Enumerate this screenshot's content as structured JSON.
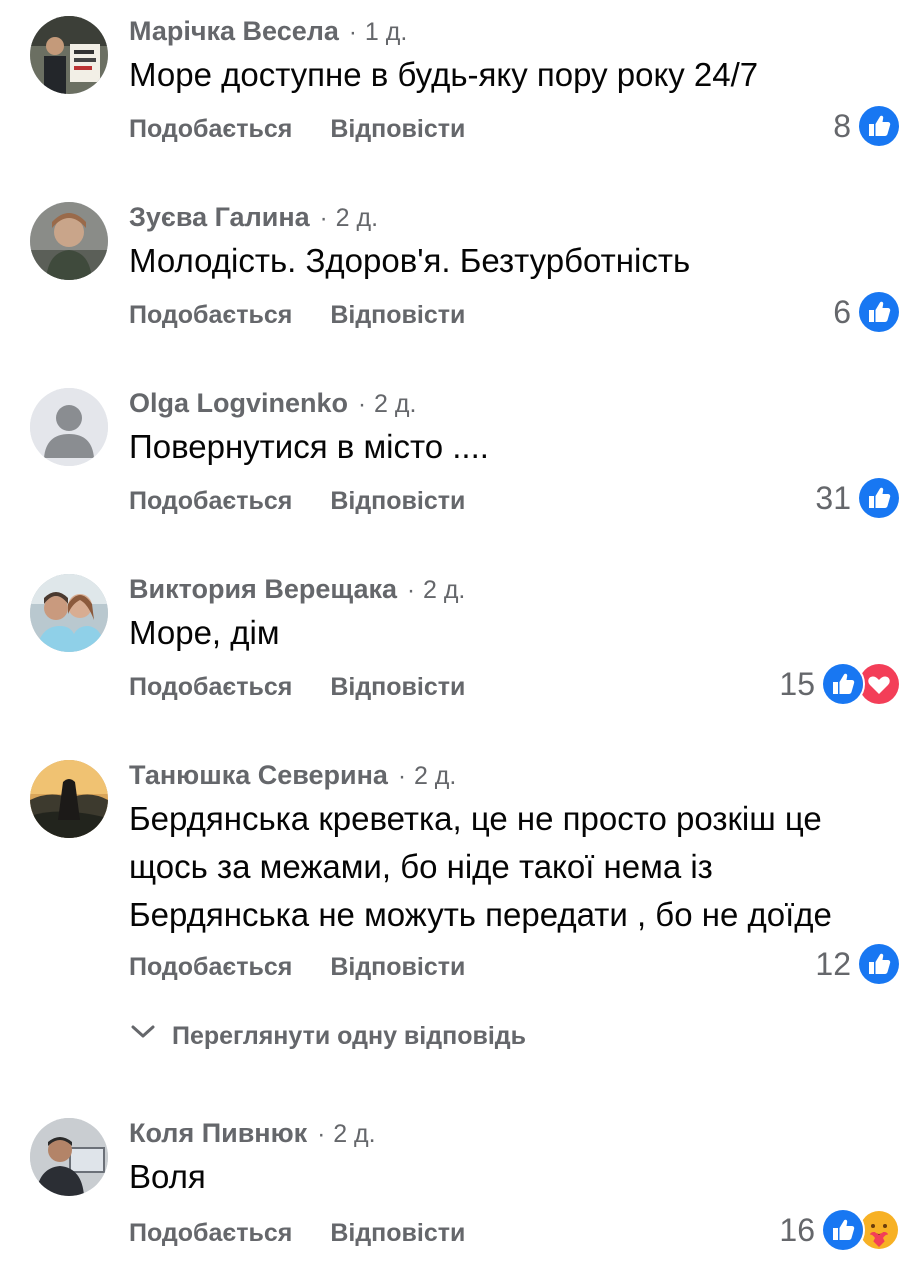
{
  "action_labels": {
    "like": "Подобається",
    "reply": "Відповісти"
  },
  "comments": [
    {
      "author": "Марічка Весела",
      "time": "1 д.",
      "text": "Море доступне в будь-яку пору року 24/7",
      "count": "8",
      "reactions": [
        "like"
      ],
      "avatar": "photo-protest-sign"
    },
    {
      "author": "Зуєва Галина",
      "time": "2 д.",
      "text": "Молодість. Здоров'я. Безтурботність",
      "count": "6",
      "reactions": [
        "like"
      ],
      "avatar": "photo-woman"
    },
    {
      "author": "Olga Logvinenko",
      "time": "2 д.",
      "text": "Повернутися в місто ....",
      "count": "31",
      "reactions": [
        "like"
      ],
      "avatar": "default-silhouette"
    },
    {
      "author": "Виктория Верещака",
      "time": "2 д.",
      "text": "Море, дім",
      "count": "15",
      "reactions": [
        "like",
        "love"
      ],
      "avatar": "photo-couple"
    },
    {
      "author": "Танюшка Северина",
      "time": "2 д.",
      "text": "Бердянська креветка, це не просто розкіш це щось за межами, бо ніде такої нема із Бердянська не можуть передати , бо не доїде",
      "text_lines": [
        "Бердянська креветка, це не просто розкіш це",
        "щось за межами, бо ніде такої нема із",
        "Бердянська не можуть передати , бо не доїде"
      ],
      "count": "12",
      "reactions": [
        "like"
      ],
      "avatar": "photo-sunset-figure"
    },
    {
      "author": "Коля Пивнюк",
      "time": "2 д.",
      "text": "Воля",
      "count": "16",
      "reactions": [
        "like",
        "care"
      ],
      "avatar": "photo-man-computer"
    }
  ],
  "view_replies": {
    "label": "Переглянути одну відповідь",
    "icon": "chevron-down-icon"
  },
  "colors": {
    "text": "#050505",
    "secondary": "#65676b",
    "like": "#1877f2",
    "love": "#f33e58",
    "care": "#f7b125"
  }
}
